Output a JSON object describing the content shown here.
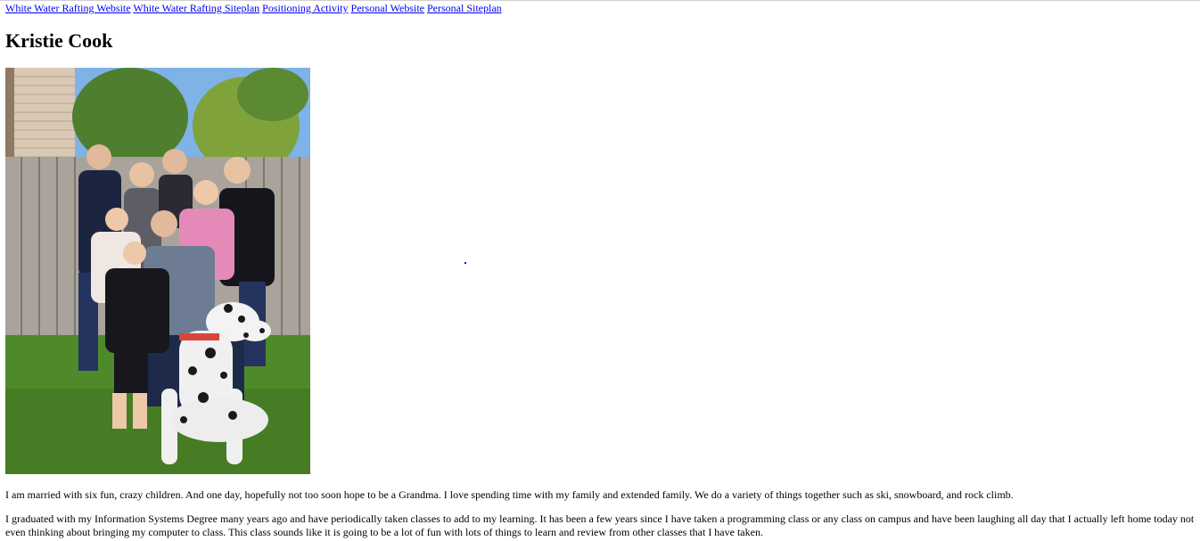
{
  "nav": {
    "links": [
      "White Water Rafting Website",
      "White Water Rafting Siteplan",
      "Positioning Activity",
      "Personal Website",
      "Personal Siteplan"
    ]
  },
  "page": {
    "title": "Kristie Cook"
  },
  "photo": {
    "subject": "family-photo"
  },
  "paragraphs": [
    "I am married with six fun, crazy children. And one day, hopefully not too soon hope to be a Grandma. I love spending time with my family and extended family. We do a variety of things together such as ski, snowboard, and rock climb.",
    "I graduated with my Information Systems Degree many years ago and have periodically taken classes to add to my learning. It has been a few years since I have taken a programming class or any class on campus and have been laughing all day that I actually left home today not even thinking about bringing my computer to class. This class sounds like it is going to be a lot of fun with lots of things to learn and review from other classes that I have taken."
  ],
  "colors": {
    "link": "#0000ee",
    "text": "#000000",
    "background": "#ffffff"
  }
}
